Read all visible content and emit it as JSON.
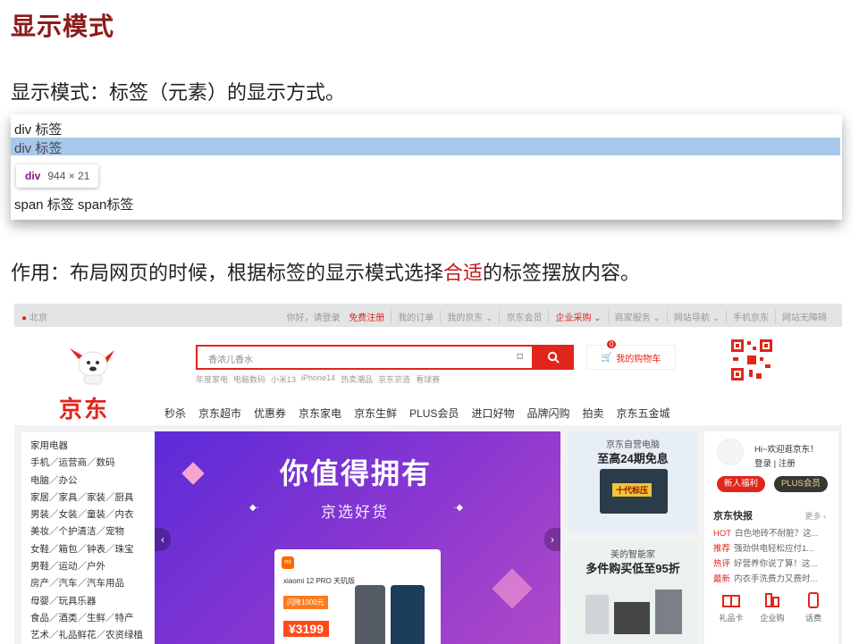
{
  "slide": {
    "title": "显示模式",
    "intro": "显示模式：标签（元素）的显示方式。",
    "usage_prefix": "作用：布局网页的时候，根据标签的显示模式选择",
    "usage_accent": "合适",
    "usage_suffix": "的标签摆放内容。",
    "accent_color": "#c21a1a"
  },
  "devtools_demo": {
    "line1": "div 标签",
    "line2": "div 标签",
    "tooltip_tag": "div",
    "tooltip_size": "944 × 21",
    "line3": "span 标签 span标签",
    "highlight_color": "#a8c8ea"
  },
  "jd": {
    "brand_color": "#e1251b",
    "location": "北京",
    "topbar": [
      "你好，请登录",
      "免费注册",
      "我的订单",
      "我的京东 ⌄",
      "京东会员",
      "企业采购 ⌄",
      "商家服务 ⌄",
      "网站导航 ⌄",
      "手机京东",
      "网站无障碍"
    ],
    "logo_text": "京东",
    "search_placeholder": "香浓儿香水",
    "hot_words": [
      "年度家电",
      "电脑数码",
      "小米13",
      "iPhone14",
      "热卖潮品",
      "京东京造",
      "看球赛"
    ],
    "cart_label": "我的购物车",
    "cart_count": "0",
    "nav": [
      "秒杀",
      "京东超市",
      "优惠券",
      "京东家电",
      "京东生鲜",
      "PLUS会员",
      "进口好物",
      "品牌闪购",
      "拍卖",
      "京东五金城"
    ],
    "categories": [
      "家用电器",
      "手机／运营商／数码",
      "电脑／办公",
      "家居／家具／家装／厨具",
      "男装／女装／童装／内衣",
      "美妆／个护清洁／宠物",
      "女鞋／箱包／钟表／珠宝",
      "男鞋／运动／户外",
      "房产／汽车／汽车用品",
      "母婴／玩具乐器",
      "食品／酒类／生鲜／特产",
      "艺术／礼品鲜花／农资绿植"
    ],
    "banner": {
      "title": "你值得拥有",
      "subtitle": "京选好货",
      "card_brand": "xiaomi 12 PRO 天玑版",
      "card_mi": "mi",
      "card_flash": "闪降1000元",
      "card_price": "¥3199"
    },
    "promo1": {
      "line1": "京东自营电脑",
      "line2": "至高24期免息",
      "badge": "十代标压"
    },
    "promo2": {
      "line1": "美的智能家",
      "line2": "多件购买低至95折"
    },
    "side": {
      "greeting": "Hi~欢迎逛京东！",
      "login": "登录 | 注册",
      "btn_new": "新人福利",
      "btn_plus": "PLUS会员",
      "news_title": "京东快报",
      "news_more": "更多 ›",
      "news": [
        {
          "tag": "HOT",
          "text": "白色地砖不耐脏？这..."
        },
        {
          "tag": "推荐",
          "text": "强劲供电轻松应付1..."
        },
        {
          "tag": "热评",
          "text": "好营养你说了算！这..."
        },
        {
          "tag": "最新",
          "text": "内衣手洗费力又费时..."
        }
      ],
      "services": [
        "礼品卡",
        "企业购",
        "话费"
      ]
    }
  }
}
